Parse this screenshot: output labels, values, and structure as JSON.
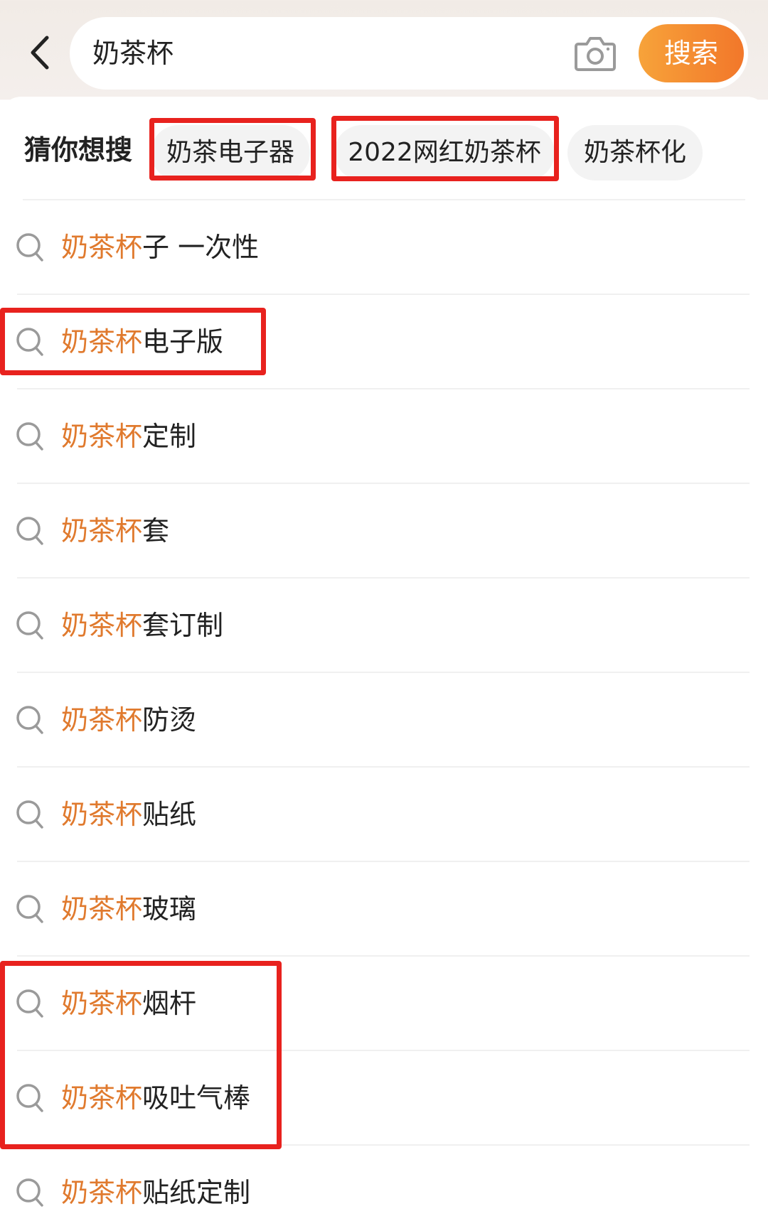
{
  "search": {
    "query": "奶茶杯",
    "button_label": "搜索"
  },
  "guess": {
    "label": "猜你想搜",
    "chips": [
      "奶茶电子器",
      "2022网红奶茶杯",
      "奶茶杯化"
    ]
  },
  "suggestions": [
    {
      "prefix": "奶茶杯",
      "suffix": "子 一次性"
    },
    {
      "prefix": "奶茶杯",
      "suffix": "电子版"
    },
    {
      "prefix": "奶茶杯",
      "suffix": "定制"
    },
    {
      "prefix": "奶茶杯",
      "suffix": "套"
    },
    {
      "prefix": "奶茶杯",
      "suffix": "套订制"
    },
    {
      "prefix": "奶茶杯",
      "suffix": "防烫"
    },
    {
      "prefix": "奶茶杯",
      "suffix": "贴纸"
    },
    {
      "prefix": "奶茶杯",
      "suffix": "玻璃"
    },
    {
      "prefix": "奶茶杯",
      "suffix": "烟杆"
    },
    {
      "prefix": "奶茶杯",
      "suffix": "吸吐气棒"
    },
    {
      "prefix": "奶茶杯",
      "suffix": "贴纸定制"
    }
  ],
  "icons": {
    "back": "chevron-left-icon",
    "camera": "camera-icon",
    "suggestion": "search-icon"
  },
  "colors": {
    "highlight": "#e07a2e",
    "search_button": "#f2772a",
    "annotation_box": "#e8221e"
  }
}
